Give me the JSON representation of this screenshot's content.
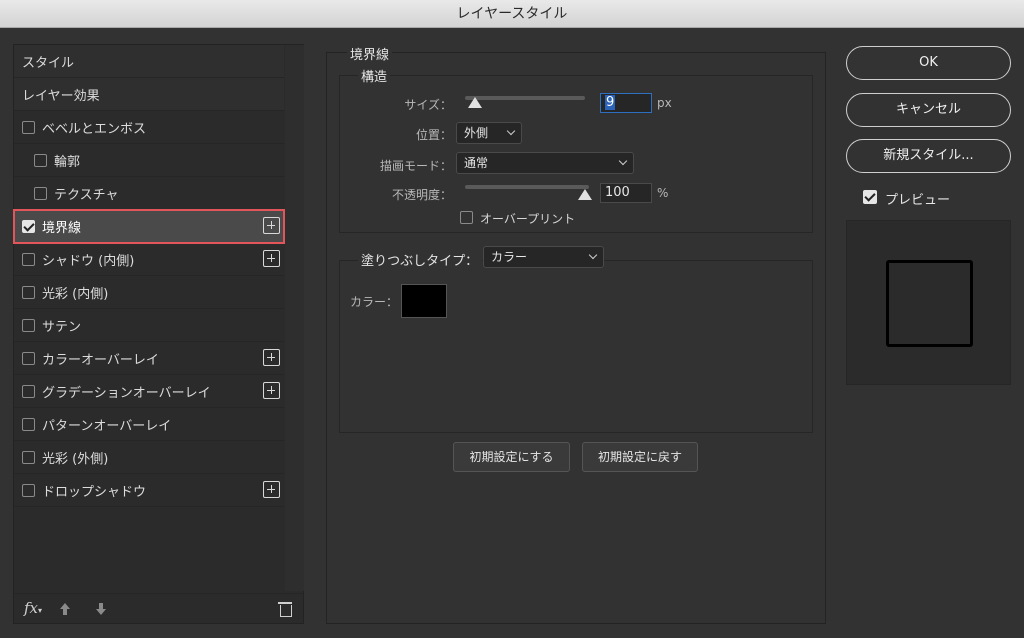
{
  "window": {
    "title": "レイヤースタイル"
  },
  "style_list": {
    "items": [
      {
        "label": "スタイル",
        "kind": "header"
      },
      {
        "label": "レイヤー効果",
        "kind": "header"
      },
      {
        "label": "ベベルとエンボス",
        "checked": false,
        "plus": false,
        "indent": false
      },
      {
        "label": "輪郭",
        "checked": false,
        "plus": false,
        "indent": true
      },
      {
        "label": "テクスチャ",
        "checked": false,
        "plus": false,
        "indent": true
      },
      {
        "label": "境界線",
        "checked": true,
        "plus": true,
        "indent": false,
        "selected": true
      },
      {
        "label": "シャドウ (内側)",
        "checked": false,
        "plus": true,
        "indent": false
      },
      {
        "label": "光彩 (内側)",
        "checked": false,
        "plus": false,
        "indent": false
      },
      {
        "label": "サテン",
        "checked": false,
        "plus": false,
        "indent": false
      },
      {
        "label": "カラーオーバーレイ",
        "checked": false,
        "plus": true,
        "indent": false
      },
      {
        "label": "グラデーションオーバーレイ",
        "checked": false,
        "plus": true,
        "indent": false
      },
      {
        "label": "パターンオーバーレイ",
        "checked": false,
        "plus": false,
        "indent": false
      },
      {
        "label": "光彩 (外側)",
        "checked": false,
        "plus": false,
        "indent": false
      },
      {
        "label": "ドロップシャドウ",
        "checked": false,
        "plus": true,
        "indent": false
      }
    ],
    "bottom": {
      "fx_label": "fx"
    }
  },
  "stroke": {
    "section_title": "境界線",
    "structure": {
      "title": "構造",
      "size_label": "サイズ：",
      "size_value": "9",
      "size_unit": "px",
      "position_label": "位置：",
      "position_value": "外側",
      "blend_label": "描画モード：",
      "blend_value": "通常",
      "opacity_label": "不透明度：",
      "opacity_value": "100",
      "opacity_unit": "%",
      "overprint_label": "オーバープリント"
    },
    "fill": {
      "type_label": "塗りつぶしタイプ：",
      "type_value": "カラー",
      "color_label": "カラー：",
      "color_value": "#000000"
    },
    "buttons": {
      "make_default": "初期設定にする",
      "reset_default": "初期設定に戻す"
    }
  },
  "right": {
    "ok": "OK",
    "cancel": "キャンセル",
    "new_style": "新規スタイル...",
    "preview_label": "プレビュー",
    "preview_checked": true
  },
  "colors": {
    "selection_outline": "#e2555a",
    "focus_blue": "#2a63b8"
  }
}
